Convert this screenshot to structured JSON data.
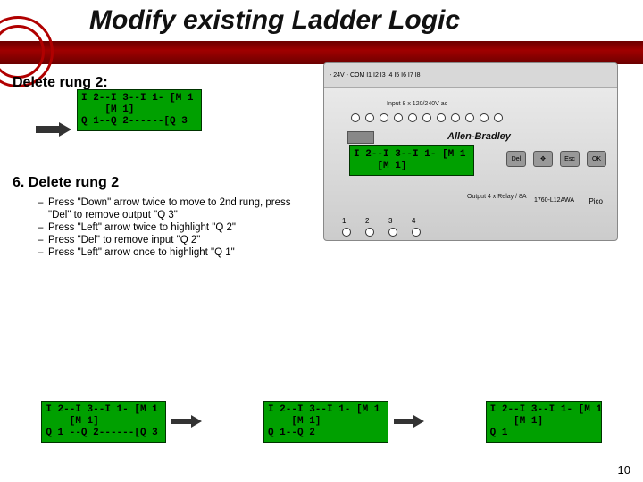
{
  "title": "Modify existing Ladder Logic",
  "subheading1": "Delete rung 2:",
  "subheading2": "6. Delete rung 2",
  "bullets": [
    "Press \"Down\" arrow twice to move to 2nd rung, press \"Del\" to remove output \"Q 3\"",
    "Press \"Left\" arrow twice to highlight \"Q 2\"",
    "Press \"Del\" to remove input \"Q 2\"",
    "Press \"Left\" arrow once to highlight \"Q 1\""
  ],
  "ladder": {
    "top": {
      "line1": "I 2--I 3--I 1- [M 1",
      "line2": "    [M 1]",
      "line3": "Q 1--Q 2------[Q 3"
    },
    "mid": {
      "line1": "I 2--I 3--I 1- [M 1",
      "line2": "    [M 1]"
    },
    "b1": {
      "line1": "I 2--I 3--I 1- [M 1",
      "line2": "    [M 1]",
      "line3": "Q 1 --Q 2------[Q 3"
    },
    "b2": {
      "line1": "I 2--I 3--I 1- [M 1",
      "line2": "    [M 1]",
      "line3": "Q 1--Q 2"
    },
    "b3": {
      "line1": "I 2--I 3--I 1- [M 1",
      "line2": "    [M 1]",
      "line3": "Q 1"
    }
  },
  "device": {
    "top_labels": "- 24V -   COM   I1   I2   I3   I4   I5   I6   I7   I8",
    "input_label": "Input 8 x 120/240V ac",
    "brand": "Allen-Bradley",
    "buttons": {
      "del": "Del",
      "esc": "Esc",
      "ok": "OK"
    },
    "output_label": "Output\n4 x Relay / 8A",
    "pico": "Pico",
    "partno": "1760-L12AWA",
    "bottom_nums": [
      "1",
      "2",
      "3",
      "4"
    ]
  },
  "page_number": "10"
}
